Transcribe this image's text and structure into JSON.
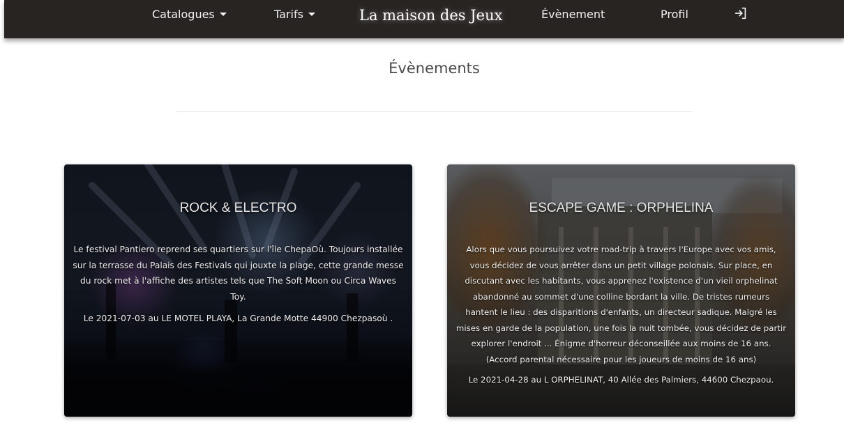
{
  "nav": {
    "catalogues": "Catalogues",
    "tarifs": "Tarifs",
    "brand": "La maison des Jeux",
    "evenement": "Évènement",
    "profil": "Profil",
    "login_icon": "login-icon"
  },
  "page": {
    "title": "Évènements"
  },
  "events": [
    {
      "title": "ROCK & ELECTRO",
      "description": "Le festival Pantiero reprend ses quartiers sur l'île ChepaOù. Toujours installée sur la terrasse du Palais des Festivals qui jouxte la plage, cette grande messe du rock met à l'affiche des artistes tels que The Soft Moon ou Circa Waves Toy.",
      "date": "Le 2021-07-03 au LE MOTEL PLAYA, La Grande Motte 44900 Chezpasoù ."
    },
    {
      "title": "ESCAPE GAME : ORPHELINA",
      "description": "Alors que vous poursuivez votre road-trip à travers l'Europe avec vos amis, vous décidez de vous arrêter dans un petit village polonais. Sur place, en discutant avec les habitants, vous apprenez l'existence d'un vieil orphelinat abandonné au sommet d'une colline bordant la ville. De tristes rumeurs hantent le lieu : des disparitions d'enfants, un directeur sadique. Malgré les mises en garde de la population, une fois la nuit tombée, vous décidez de partir explorer l'endroit ... Énigme d'horreur déconseillée aux moins de 16 ans. (Accord parental nécessaire pour les joueurs de moins de 16 ans)",
      "date": "Le 2021-04-28 au L ORPHELINAT, 40 Allée des Palmiers, 44600 Chezpaou."
    }
  ]
}
